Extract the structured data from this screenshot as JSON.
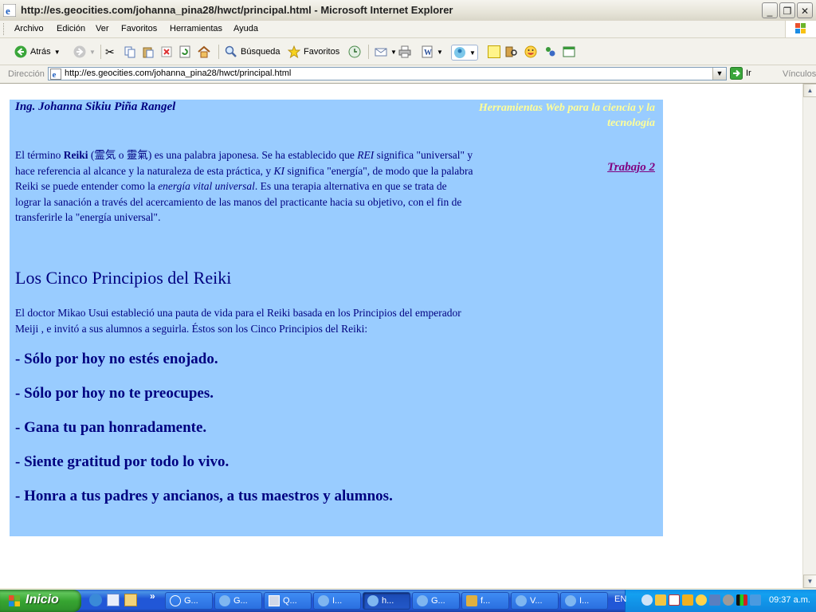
{
  "window": {
    "title": "http://es.geocities.com/johanna_pina28/hwct/principal.html - Microsoft Internet Explorer",
    "minimize": "_",
    "maximize": "❐",
    "close": "✕"
  },
  "menu": [
    "Archivo",
    "Edición",
    "Ver",
    "Favoritos",
    "Herramientas",
    "Ayuda"
  ],
  "toolbar": {
    "back_label": "Atrás",
    "search_label": "Búsqueda",
    "favorites_label": "Favoritos"
  },
  "address": {
    "label": "Dirección",
    "url": "http://es.geocities.com/johanna_pina28/hwct/principal.html",
    "go_label": "Ir",
    "links_label": "Vínculos"
  },
  "page": {
    "author": "Ing. Johanna Sikiu Piña Rangel",
    "tagline": "Herramientas Web para la ciencia y la tecnología",
    "trabajo_link": "Trabajo 2",
    "intro_1": "El término ",
    "intro_reiki": "Reiki",
    "intro_kanji": " (霊気 o 靈氣)",
    "intro_2": " es una palabra japonesa. Se ha establecido que ",
    "intro_rei": "REI",
    "intro_3": " significa \"universal\" y hace referencia al alcance y la naturaleza de esta práctica, y ",
    "intro_ki": "KI",
    "intro_4": " significa \"energía\", de modo que la palabra Reiki se puede entender como la ",
    "intro_energia": "energía vital universal",
    "intro_5": ". Es una terapia alternativa en que se trata de lograr la sanación a través del acercamiento de las manos del practicante hacia su objetivo, con el fin de transferirle la \"energía universal\".",
    "heading": "Los Cinco Principios del Reiki",
    "description": "El doctor Mikao Usui estableció una pauta de vida para el Reiki basada en los Principios del emperador Meiji , e invitó a sus alumnos a seguirla. Éstos son los Cinco Principios del Reiki:",
    "principles": [
      "- Sólo por hoy no estés enojado.",
      "- Sólo por hoy no te preocupes.",
      "- Gana tu pan honradamente.",
      "- Siente gratitud por todo lo vivo.",
      "- Honra a tus padres y ancianos, a tus maestros y alumnos."
    ],
    "colors": {
      "background": "#99ccff",
      "text": "#000080",
      "tagline": "#ffff99",
      "link": "#800080"
    }
  },
  "taskbar": {
    "start_label": "Inicio",
    "tasks": [
      "G...",
      "G...",
      "Q...",
      "I...",
      "h...",
      "G...",
      "f...",
      "V...",
      "I..."
    ],
    "active_task": "h...",
    "language": "EN",
    "clock": "09:37 a.m."
  }
}
